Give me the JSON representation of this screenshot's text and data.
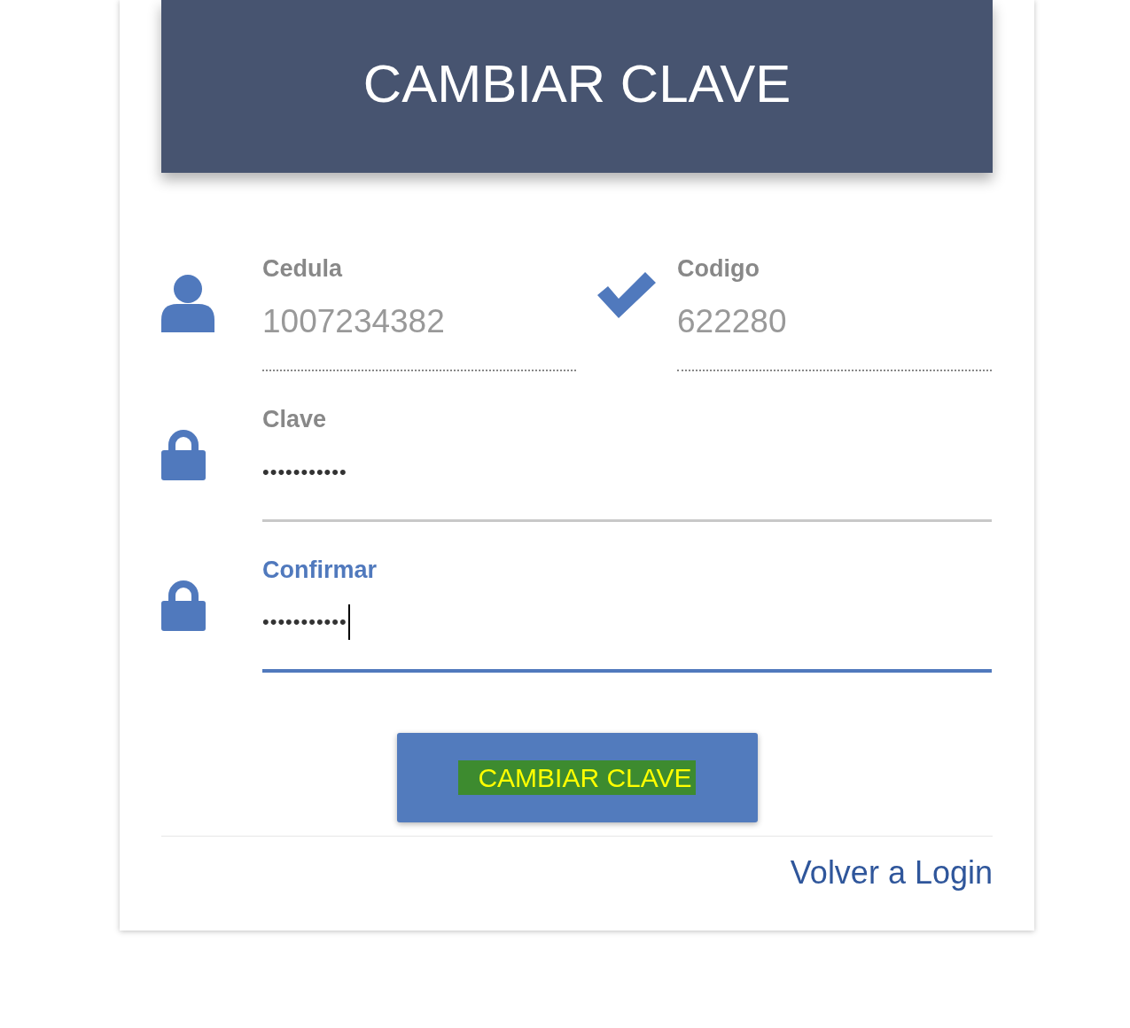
{
  "header": {
    "title": "CAMBIAR CLAVE"
  },
  "fields": [
    {
      "label": "Cedula",
      "value": "1007234382",
      "kind": "user",
      "disabled": true,
      "focused": false
    },
    {
      "label": "Codigo",
      "value": "622280",
      "kind": "check",
      "disabled": true,
      "focused": false
    },
    {
      "label": "Clave",
      "value": "•••••••••••",
      "kind": "lock",
      "disabled": false,
      "focused": false
    },
    {
      "label": "Confirmar",
      "value": "•••••••••••",
      "kind": "lock",
      "disabled": false,
      "focused": true
    }
  ],
  "submit": {
    "label": "CAMBIAR CLAVE",
    "highlighted": true
  },
  "link": "Volver a Login"
}
